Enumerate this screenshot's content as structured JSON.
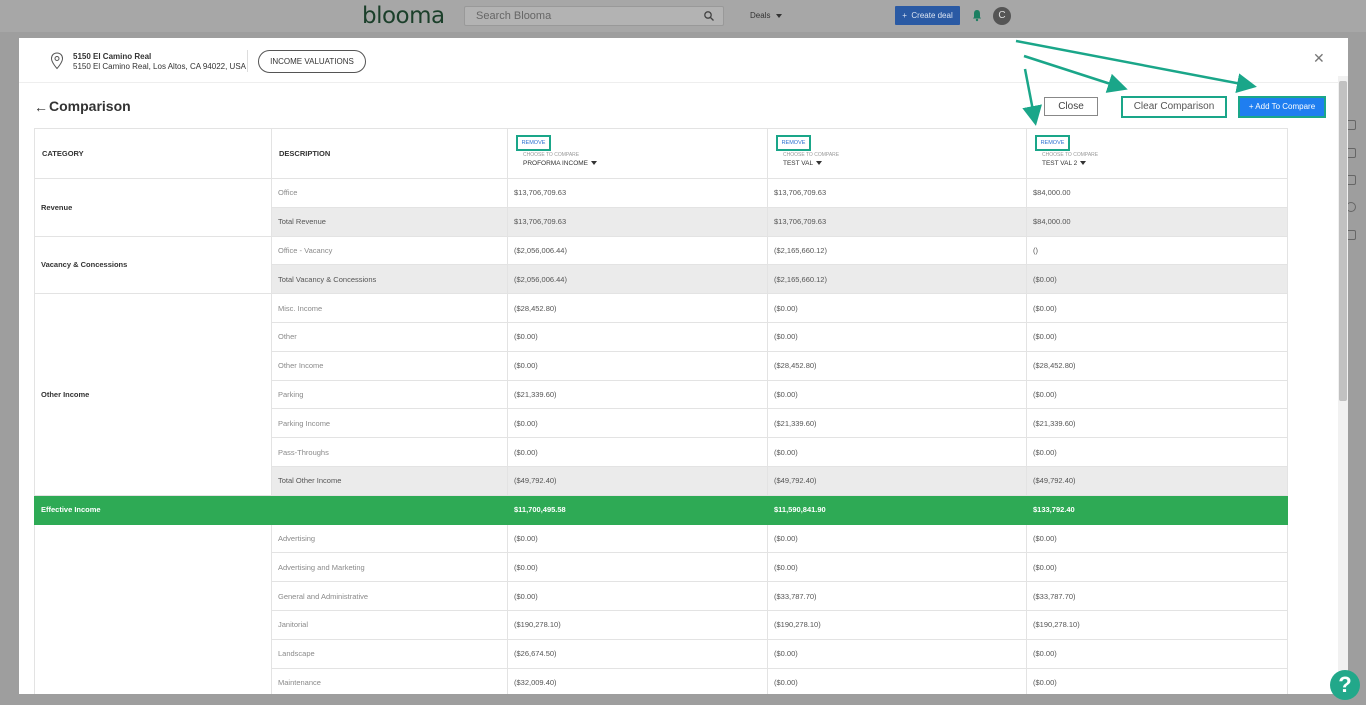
{
  "app": {
    "logo": "blooma",
    "search_placeholder": "Search Blooma",
    "deals_label": "Deals",
    "create_deal_label": "Create deal",
    "avatar_initial": "C"
  },
  "header": {
    "address_line1": "5150 El Camino Real",
    "address_line2": "5150 El Camino Real, Los Altos, CA 94022, USA",
    "tab_label": "INCOME VALUATIONS"
  },
  "page": {
    "title": "Comparison",
    "close_label": "Close",
    "clear_label": "Clear Comparison",
    "add_label": "+ Add To Compare"
  },
  "table": {
    "category_header": "CATEGORY",
    "description_header": "DESCRIPTION",
    "columns": [
      {
        "remove_label": "REMOVE",
        "choose_label": "CHOOSE TO COMPARE",
        "selected": "PROFORMA INCOME"
      },
      {
        "remove_label": "REMOVE",
        "choose_label": "CHOOSE TO COMPARE",
        "selected": "TEST VAL"
      },
      {
        "remove_label": "REMOVE",
        "choose_label": "CHOOSE TO COMPARE",
        "selected": "TEST VAL 2"
      }
    ],
    "groups": [
      {
        "category": "Revenue",
        "rows": [
          {
            "desc": "Office",
            "total": false,
            "values": [
              "$13,706,709.63",
              "$13,706,709.63",
              "$84,000.00"
            ]
          },
          {
            "desc": "Total Revenue",
            "total": true,
            "values": [
              "$13,706,709.63",
              "$13,706,709.63",
              "$84,000.00"
            ]
          }
        ]
      },
      {
        "category": "Vacancy & Concessions",
        "rows": [
          {
            "desc": "Office - Vacancy",
            "total": false,
            "values": [
              "($2,056,006.44)",
              "($2,165,660.12)",
              "()"
            ]
          },
          {
            "desc": "Total Vacancy & Concessions",
            "total": true,
            "values": [
              "($2,056,006.44)",
              "($2,165,660.12)",
              "($0.00)"
            ]
          }
        ]
      },
      {
        "category": "Other Income",
        "rows": [
          {
            "desc": "Misc. Income",
            "total": false,
            "values": [
              "($28,452.80)",
              "($0.00)",
              "($0.00)"
            ]
          },
          {
            "desc": "Other",
            "total": false,
            "values": [
              "($0.00)",
              "($0.00)",
              "($0.00)"
            ]
          },
          {
            "desc": "Other Income",
            "total": false,
            "values": [
              "($0.00)",
              "($28,452.80)",
              "($28,452.80)"
            ]
          },
          {
            "desc": "Parking",
            "total": false,
            "values": [
              "($21,339.60)",
              "($0.00)",
              "($0.00)"
            ]
          },
          {
            "desc": "Parking Income",
            "total": false,
            "values": [
              "($0.00)",
              "($21,339.60)",
              "($21,339.60)"
            ]
          },
          {
            "desc": "Pass-Throughs",
            "total": false,
            "values": [
              "($0.00)",
              "($0.00)",
              "($0.00)"
            ]
          },
          {
            "desc": "Total Other Income",
            "total": true,
            "values": [
              "($49,792.40)",
              "($49,792.40)",
              "($49,792.40)"
            ]
          }
        ]
      }
    ],
    "effective_income": {
      "label": "Effective Income",
      "values": [
        "$11,700,495.58",
        "$11,590,841.90",
        "$133,792.40"
      ]
    },
    "expenses": {
      "category": "",
      "rows": [
        {
          "desc": "Advertising",
          "values": [
            "($0.00)",
            "($0.00)",
            "($0.00)"
          ]
        },
        {
          "desc": "Advertising and Marketing",
          "values": [
            "($0.00)",
            "($0.00)",
            "($0.00)"
          ]
        },
        {
          "desc": "General and Administrative",
          "values": [
            "($0.00)",
            "($33,787.70)",
            "($33,787.70)"
          ]
        },
        {
          "desc": "Janitorial",
          "values": [
            "($190,278.10)",
            "($190,278.10)",
            "($190,278.10)"
          ]
        },
        {
          "desc": "Landscape",
          "values": [
            "($26,674.50)",
            "($0.00)",
            "($0.00)"
          ]
        },
        {
          "desc": "Maintenance",
          "values": [
            "($32,009.40)",
            "($0.00)",
            "($0.00)"
          ]
        }
      ]
    }
  },
  "help_label": "?",
  "colors": {
    "accent": "#1aa689",
    "primary": "#1f7ef0",
    "effective_row": "#2eaa55"
  }
}
